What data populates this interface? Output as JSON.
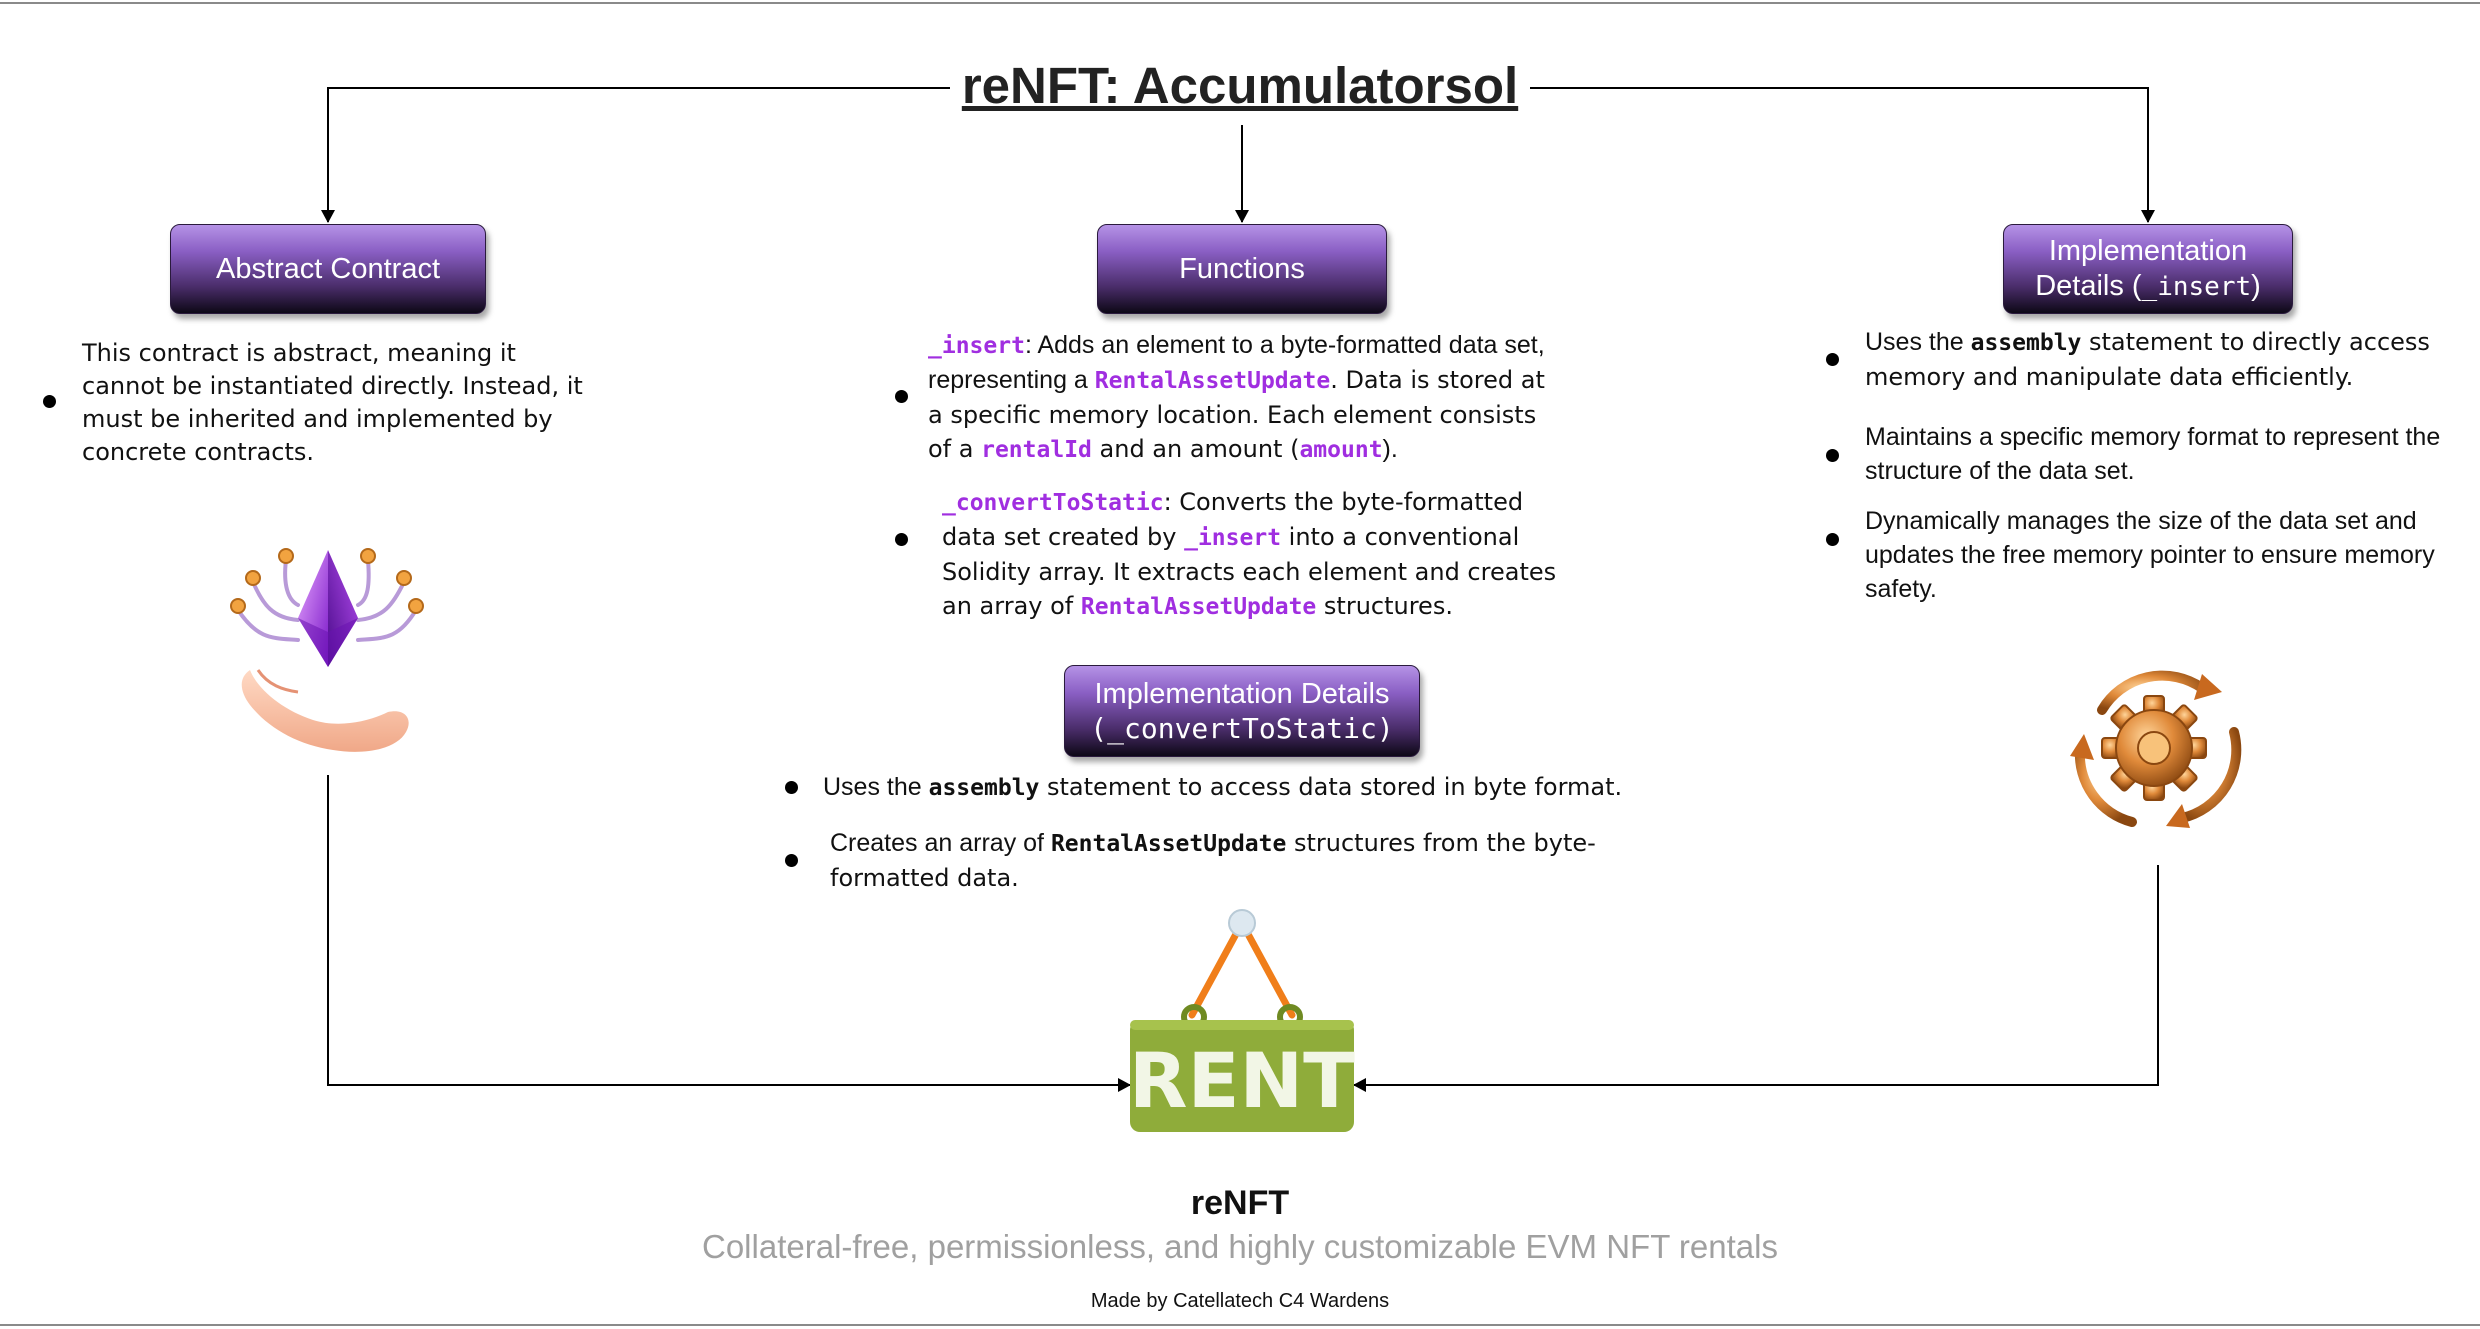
{
  "title": "reNFT: Accumulatorsol",
  "nodes": {
    "abstract_contract": {
      "label": "Abstract Contract",
      "text": "This contract is abstract, meaning it cannot be instantiated directly. Instead, it must be inherited and implemented by concrete contracts."
    },
    "functions": {
      "label": "Functions",
      "items": [
        {
          "name": "_insert",
          "t1": ": Adds an element to a byte-formatted data set, representing a ",
          "c1": "RentalAssetUpdate",
          "t2": ". Data is stored at a specific memory location. Each element consists of a ",
          "c2": "rentalId",
          "t3": " and an amount (",
          "c3": "amount",
          "t4": ")."
        },
        {
          "name": "_convertToStatic",
          "t1": ": Converts the byte-formatted data set created by ",
          "c1": "_insert",
          "t2": " into a conventional Solidity array. It extracts each element and creates an array of ",
          "c2": "RentalAssetUpdate",
          "t3": " structures."
        }
      ]
    },
    "impl_insert": {
      "label_line1": "Implementation",
      "label_line2_pre": "Details (",
      "label_line2_code": "_insert",
      "label_line2_post": ")",
      "items": [
        {
          "pre": "Uses the ",
          "code": "assembly",
          "post": " statement to directly access memory and manipulate data efficiently."
        },
        {
          "text": "Maintains a specific memory format to represent the structure of the data set."
        },
        {
          "text": "Dynamically manages the size of the data set and updates the free memory pointer to ensure memory safety."
        }
      ]
    },
    "impl_convert": {
      "label_line1": "Implementation Details",
      "label_line2": "(_convertToStatic)",
      "items": [
        {
          "pre": "Uses the ",
          "code": "assembly",
          "post": " statement to access data stored in byte format."
        },
        {
          "pre": "Creates an array of ",
          "code": "RentalAssetUpdate",
          "post": " structures from the byte-formatted data."
        }
      ]
    }
  },
  "sign": {
    "text": "RENT"
  },
  "footer": {
    "name": "reNFT",
    "tagline": "Collateral-free, permissionless, and highly customizable EVM NFT rentals",
    "credit": "Made by Catellatech C4 Wardens"
  },
  "colors": {
    "pill_top": "#b592e6",
    "pill_bottom": "#0d0816",
    "code_accent": "#a02ee0",
    "sign_green": "#8fac3a",
    "tagline_gray": "#a0a0a0"
  },
  "icons": [
    "ethereum-hand-icon",
    "gear-cycle-icon",
    "rent-sign-icon"
  ]
}
